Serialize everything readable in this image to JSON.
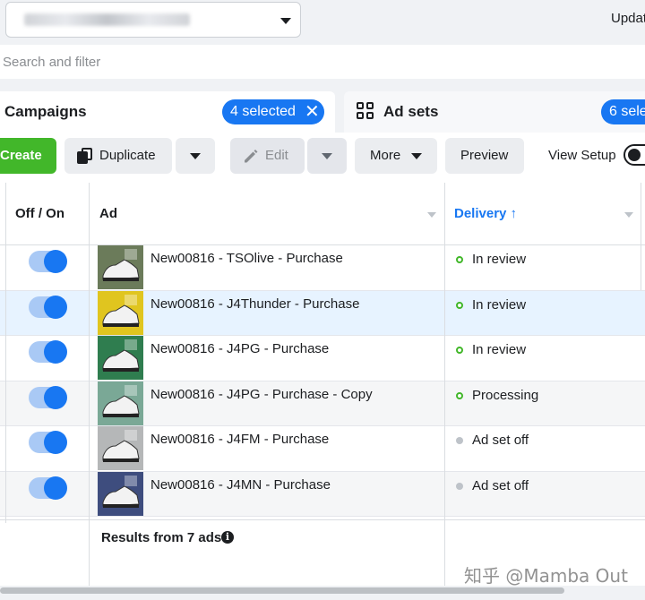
{
  "account": {
    "name": "\"• •• • (•••••••••• •)"
  },
  "top": {
    "update_label": "Updat"
  },
  "search": {
    "placeholder": "Search and filter",
    "value": ""
  },
  "tabs": {
    "campaigns": {
      "label": "Campaigns",
      "selected_badge": "4 selected"
    },
    "adsets": {
      "label": "Ad sets",
      "selected_badge": "6 sele"
    }
  },
  "toolbar": {
    "create_label": "Create",
    "duplicate_label": "Duplicate",
    "edit_label": "Edit",
    "more_label": "More",
    "preview_label": "Preview",
    "view_setup_label": "View Setup"
  },
  "table": {
    "headers": {
      "toggle": "Off / On",
      "ad": "Ad",
      "delivery": "Delivery"
    },
    "rows": [
      {
        "name": "New00816 - TSOlive - Purchase",
        "status": "In review",
        "status_kind": "review",
        "thumb_color": "#6b7b5a"
      },
      {
        "name": "New00816 - J4Thunder - Purchase",
        "status": "In review",
        "status_kind": "review",
        "thumb_color": "#e0c51f"
      },
      {
        "name": "New00816 - J4PG - Purchase",
        "status": "In review",
        "status_kind": "review",
        "thumb_color": "#2f7d4f"
      },
      {
        "name": "New00816 - J4PG - Purchase - Copy",
        "status": "Processing",
        "status_kind": "review",
        "thumb_color": "#7aa896"
      },
      {
        "name": "New00816 - J4FM - Purchase",
        "status": "Ad set off",
        "status_kind": "off",
        "thumb_color": "#b5b7b8"
      },
      {
        "name": "New00816 - J4MN - Purchase",
        "status": "Ad set off",
        "status_kind": "off",
        "thumb_color": "#3e4d7e"
      }
    ],
    "results_label": "Results from 7 ads"
  },
  "watermark": "知乎 @Mamba Out",
  "colors": {
    "accent": "#1877f2",
    "create": "#42b72a",
    "selected_row": "#e7f3ff"
  }
}
